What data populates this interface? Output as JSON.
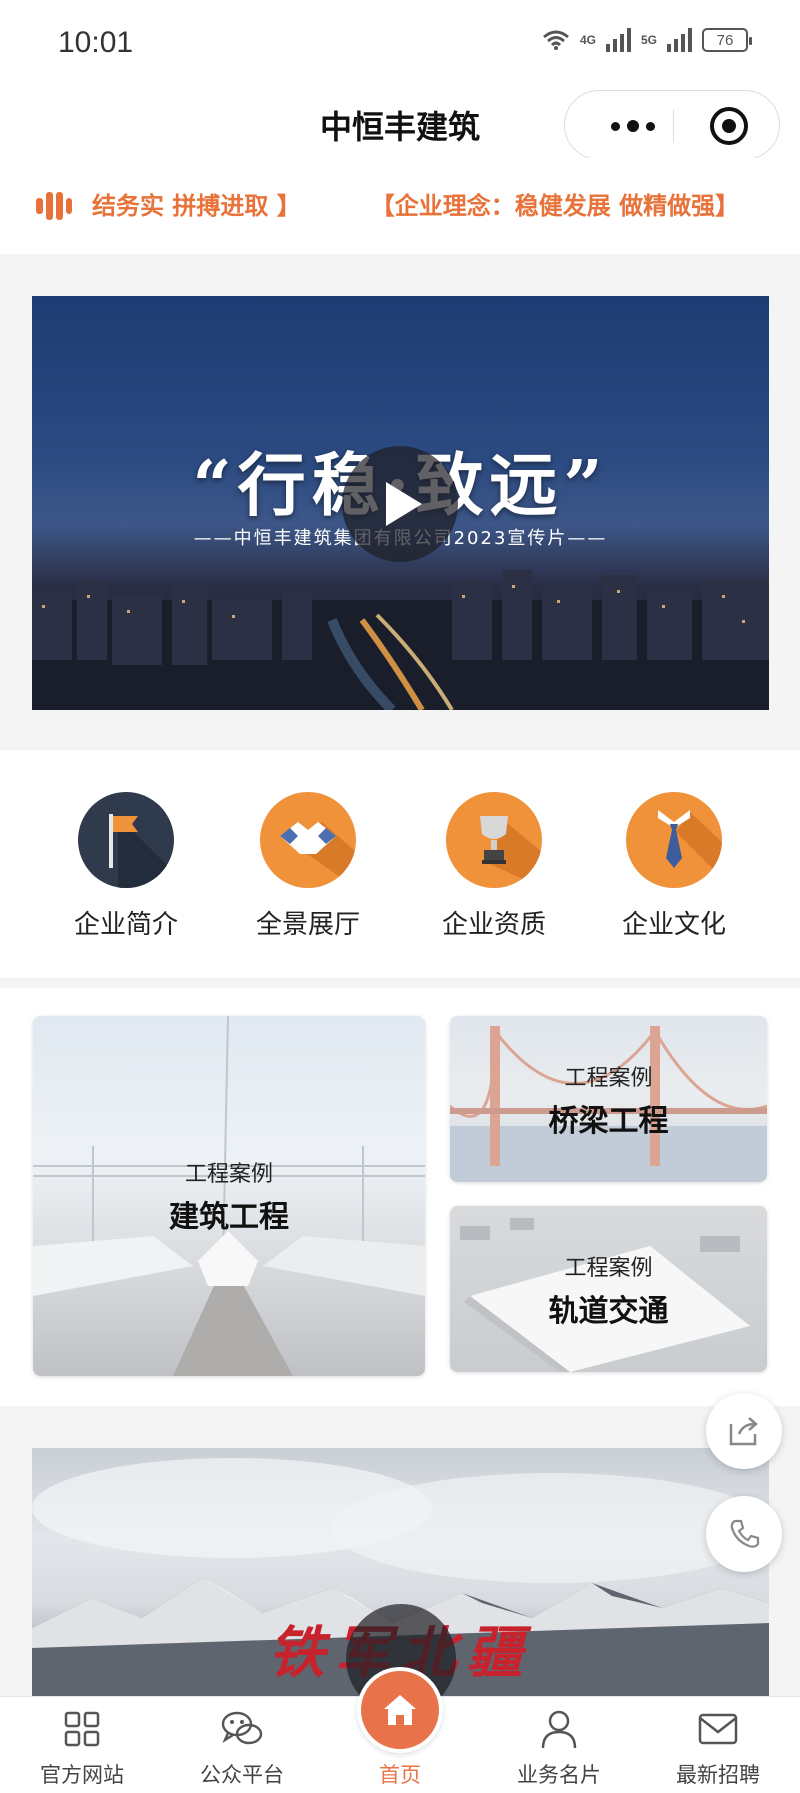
{
  "status_bar": {
    "time": "10:01",
    "network_1": "4G",
    "network_2": "5G",
    "battery": "76"
  },
  "nav": {
    "title": "中恒丰建筑"
  },
  "marquee": {
    "text_1": "结务实 拼搏进取 】",
    "text_2": "【企业理念：稳健发展 做精做强】",
    "accent": "#e8733a"
  },
  "video_banner": {
    "title": "“行稳·致远”",
    "subtitle": "——中恒丰建筑集团有限公司2023宣传片——"
  },
  "menu": [
    {
      "label": "企业简介",
      "icon": "flag-icon",
      "color": "#2f3a4c"
    },
    {
      "label": "全景展厅",
      "icon": "handshake-icon",
      "color": "#f0923a"
    },
    {
      "label": "企业资质",
      "icon": "trophy-icon",
      "color": "#f0923a"
    },
    {
      "label": "企业文化",
      "icon": "necktie-icon",
      "color": "#f0923a"
    }
  ],
  "cards": [
    {
      "sub": "工程案例",
      "main": "建筑工程"
    },
    {
      "sub": "工程案例",
      "main": "桥梁工程"
    },
    {
      "sub": "工程案例",
      "main": "轨道交通"
    }
  ],
  "lower_banner": {
    "title": "铁军北疆"
  },
  "tabbar": [
    {
      "label": "官方网站",
      "icon": "grid-icon"
    },
    {
      "label": "公众平台",
      "icon": "wechat-icon"
    },
    {
      "label": "首页",
      "icon": "home-icon",
      "active": true
    },
    {
      "label": "业务名片",
      "icon": "user-icon"
    },
    {
      "label": "最新招聘",
      "icon": "mail-icon"
    }
  ],
  "colors": {
    "brand": "#e8734a",
    "dark": "#2f3a4c"
  }
}
